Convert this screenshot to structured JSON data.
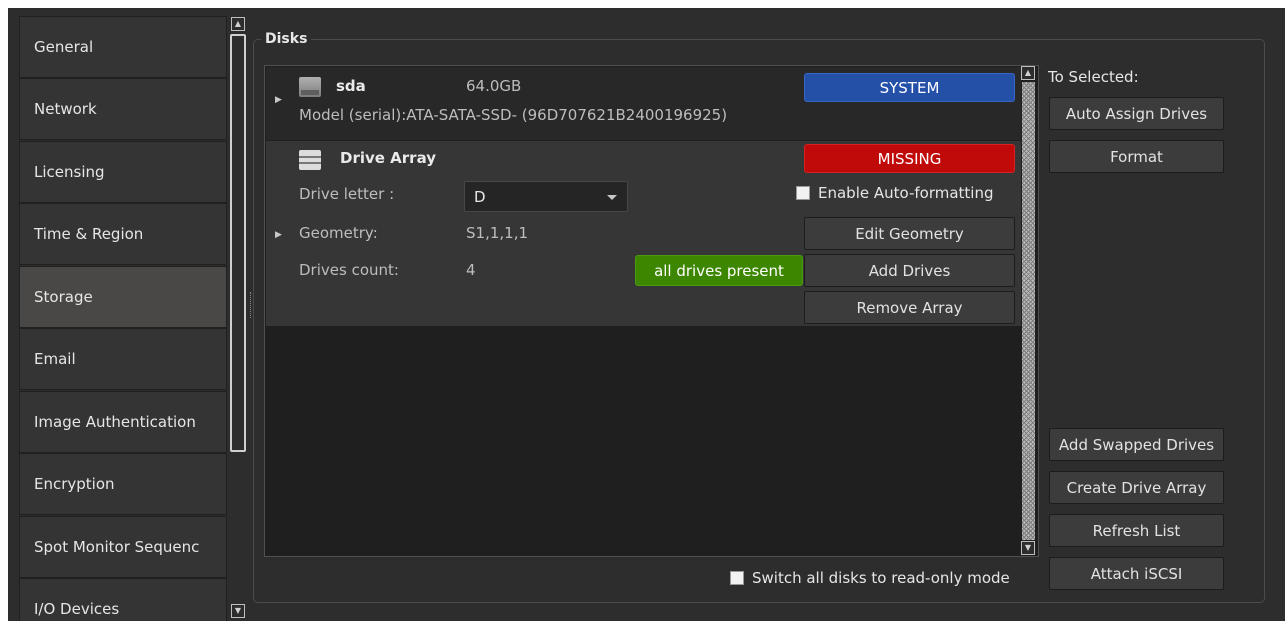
{
  "sidebar": {
    "items": [
      {
        "label": "General"
      },
      {
        "label": "Network"
      },
      {
        "label": "Licensing"
      },
      {
        "label": "Time & Region"
      },
      {
        "label": "Storage"
      },
      {
        "label": "Email"
      },
      {
        "label": "Image Authentication"
      },
      {
        "label": "Encryption"
      },
      {
        "label": "Spot Monitor Sequenc"
      },
      {
        "label": "I/O Devices"
      }
    ],
    "active": "Storage"
  },
  "disks": {
    "title": "Disks",
    "sda": {
      "name": "sda",
      "size": "64.0GB",
      "model": "Model (serial):ATA-SATA-SSD- (96D707621B2400196925)",
      "status": "SYSTEM"
    },
    "array": {
      "name": "Drive Array",
      "status": "MISSING",
      "drive_letter_label": "Drive letter :",
      "drive_letter_value": "D",
      "auto_format_label": "Enable Auto-formatting",
      "geometry_label": "Geometry:",
      "geometry_value": "S1,1,1,1",
      "drives_count_label": "Drives count:",
      "drives_count_value": "4",
      "drives_status": "all drives present",
      "edit_geometry": "Edit Geometry",
      "add_drives": "Add Drives",
      "remove_array": "Remove Array"
    },
    "read_only_label": "Switch all disks to read-only mode"
  },
  "actions": {
    "to_selected": "To Selected:",
    "auto_assign": "Auto Assign Drives",
    "format": "Format",
    "add_swapped": "Add Swapped Drives",
    "create_array": "Create Drive Array",
    "refresh": "Refresh List",
    "attach_iscsi": "Attach iSCSI"
  },
  "colors": {
    "system": "#2450a8",
    "missing": "#c00a0a",
    "present": "#3d8600",
    "selected_nav": "#4a4846"
  },
  "icons": [
    "hard-disk-icon",
    "drive-array-icon",
    "expand-arrow-icon",
    "dropdown-arrow-icon",
    "scroll-up-icon",
    "scroll-down-icon"
  ]
}
